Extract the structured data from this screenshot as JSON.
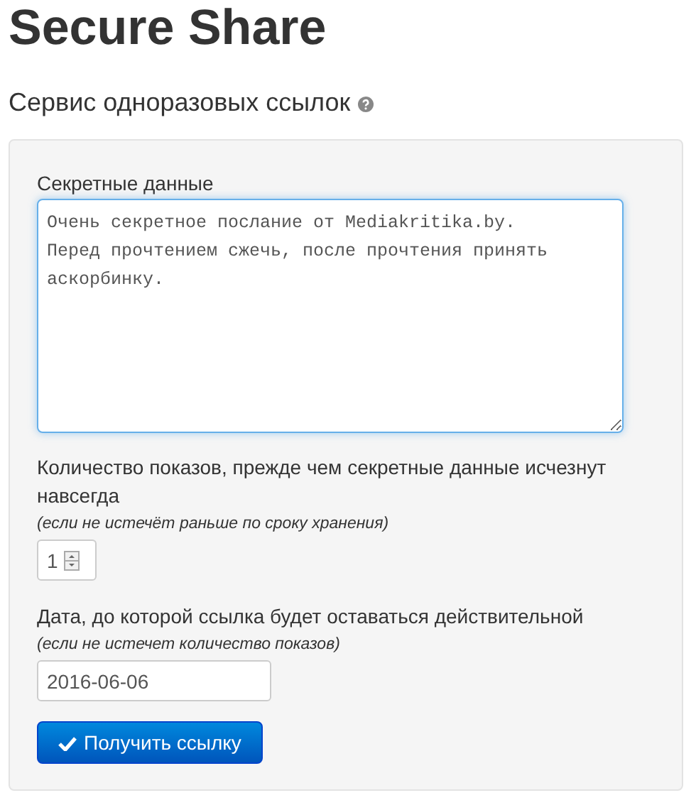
{
  "title": "Secure Share",
  "subtitle": "Сервис одноразовых ссылок",
  "form": {
    "secret": {
      "label": "Секретные данные",
      "value": "Очень секретное послание от Mediakritika.by.\nПеред прочтением сжечь, после прочтения принять аскорбинку."
    },
    "views": {
      "label": "Количество показов, прежде чем секретные данные исчезнут навсегда",
      "hint": "(если не истечёт раньше по сроку хранения)",
      "value": "1"
    },
    "date": {
      "label": "Дата, до которой ссылка будет оставаться действительной",
      "hint": "(если не истечет количество показов)",
      "value": "2016-06-06"
    },
    "submit": "Получить ссылку"
  }
}
